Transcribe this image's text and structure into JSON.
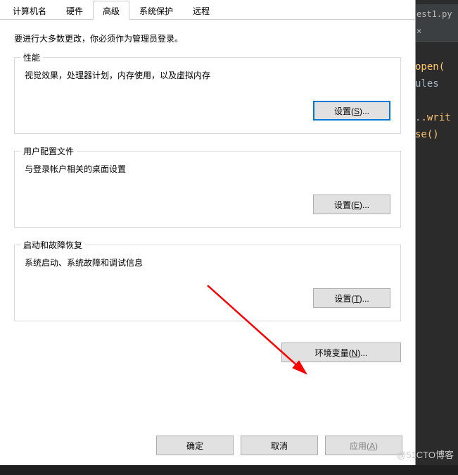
{
  "code_editor": {
    "tab": "est1.py",
    "lines": [
      "open(",
      "ules",
      ".writ",
      "se()"
    ]
  },
  "dialog": {
    "tabs": [
      {
        "label": "计算机名",
        "active": false
      },
      {
        "label": "硬件",
        "active": false
      },
      {
        "label": "高级",
        "active": true
      },
      {
        "label": "系统保护",
        "active": false
      },
      {
        "label": "远程",
        "active": false
      }
    ],
    "info": "要进行大多数更改，你必须作为管理员登录。",
    "groups": {
      "performance": {
        "title": "性能",
        "desc": "视觉效果，处理器计划，内存使用，以及虚拟内存",
        "button": {
          "label": "设置(",
          "accel": "S",
          "suffix": ")..."
        }
      },
      "userprofile": {
        "title": "用户配置文件",
        "desc": "与登录帐户相关的桌面设置",
        "button": {
          "label": "设置(",
          "accel": "E",
          "suffix": ")..."
        }
      },
      "startup": {
        "title": "启动和故障恢复",
        "desc": "系统启动、系统故障和调试信息",
        "button": {
          "label": "设置(",
          "accel": "T",
          "suffix": ")..."
        }
      }
    },
    "env_button": {
      "label": "环境变量(",
      "accel": "N",
      "suffix": ")..."
    },
    "bottom": {
      "ok": "确定",
      "cancel": "取消",
      "apply": {
        "label": "应用(",
        "accel": "A",
        "suffix": ")"
      }
    }
  },
  "watermark": "@51CTO博客"
}
